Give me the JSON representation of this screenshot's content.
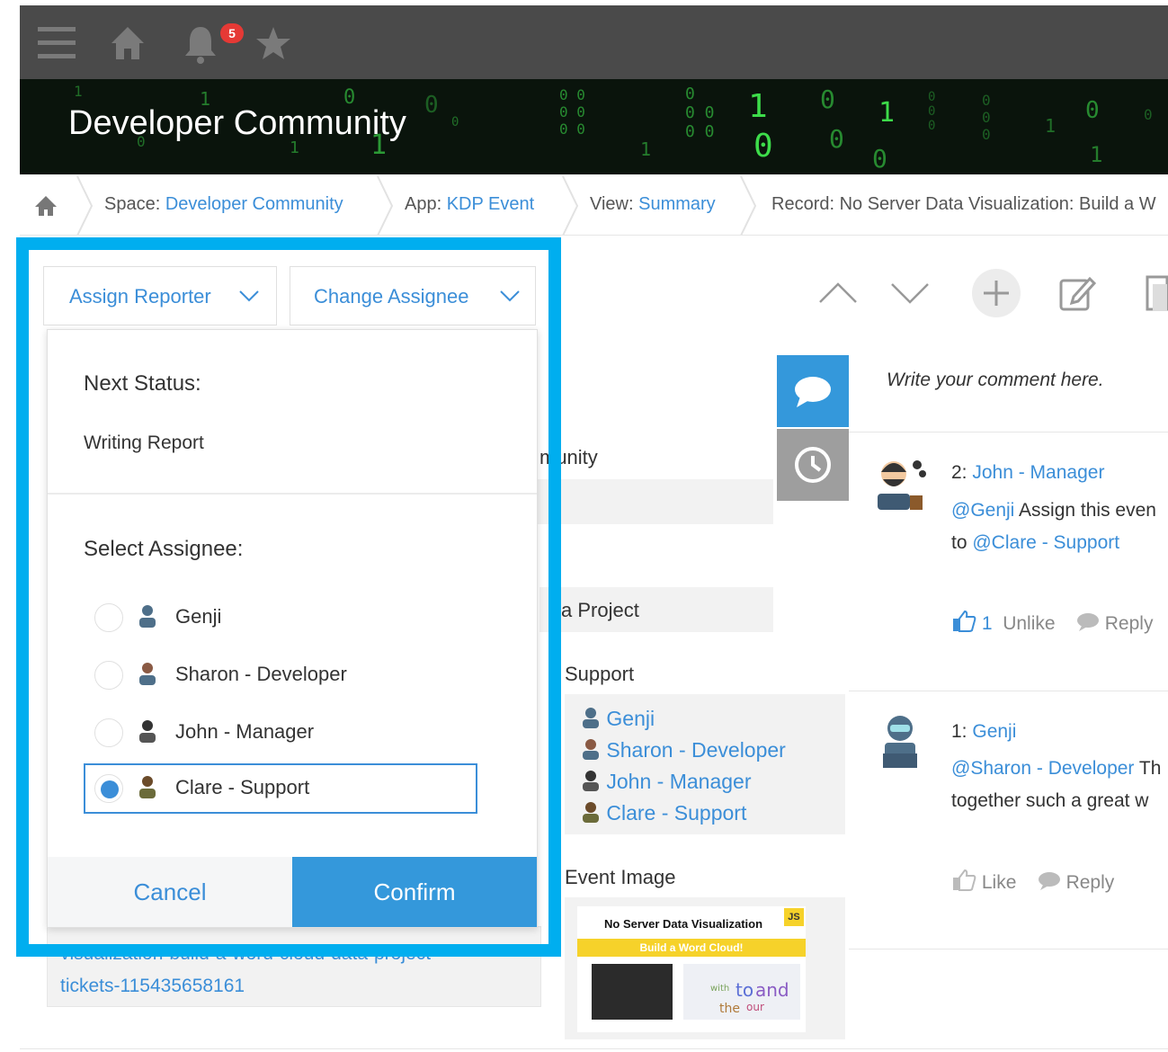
{
  "topbar": {
    "notification_count": "5"
  },
  "banner": {
    "title": "Developer Community"
  },
  "breadcrumb": {
    "space_prefix": "Space: ",
    "space_name": "Developer Community",
    "app_prefix": "App: ",
    "app_name": "KDP Event",
    "view_prefix": "View: ",
    "view_name": "Summary",
    "record_text": "Record: No Server Data Visualization: Build a W"
  },
  "actions": {
    "assign_reporter": "Assign Reporter",
    "change_assignee": "Change Assignee"
  },
  "status_dialog": {
    "next_status_heading": "Next Status:",
    "next_status_value": "Writing Report",
    "select_assignee_heading": "Select Assignee:",
    "assignees": [
      {
        "label": "Genji",
        "selected": false
      },
      {
        "label": "Sharon - Developer",
        "selected": false
      },
      {
        "label": "John - Manager",
        "selected": false
      },
      {
        "label": "Clare - Support",
        "selected": true
      }
    ],
    "cancel_label": "Cancel",
    "confirm_label": "Confirm"
  },
  "record_bg": {
    "community_fragment": "munity",
    "project_fragment": "a Project",
    "support_label": "Support",
    "users": [
      "Genji",
      "Sharon - Developer",
      "John - Manager",
      "Clare - Support"
    ],
    "event_image_label": "Event Image",
    "event_image_title": "No Server Data Visualization",
    "event_image_subtitle": "Build a Word Cloud!",
    "event_image_badge": "JS",
    "link_line_1": "visualization-build-a-word-cloud-data-project-",
    "link_line_2": "tickets-115435658161"
  },
  "comments": {
    "placeholder": "Write your comment here.",
    "items": [
      {
        "number": "2: ",
        "author": "John - Manager",
        "mention": "@Genji",
        "text_1": " Assign this even",
        "to_prefix": "to ",
        "mention_2": "@Clare - Support",
        "like_count": "1",
        "like_label": "Unlike",
        "reply_label": "Reply"
      },
      {
        "number": "1: ",
        "author": "Genji",
        "mention": "@Sharon - Developer",
        "text_1": " Th",
        "text_2": "together such a great w",
        "like_label": "Like",
        "reply_label": "Reply"
      }
    ]
  },
  "colors": {
    "accent": "#3b8ed8",
    "highlight_frame": "#00aeef",
    "confirm_bg": "#3498db",
    "topbar": "#4a4a4a",
    "matrix_green": "#2fa83a"
  }
}
